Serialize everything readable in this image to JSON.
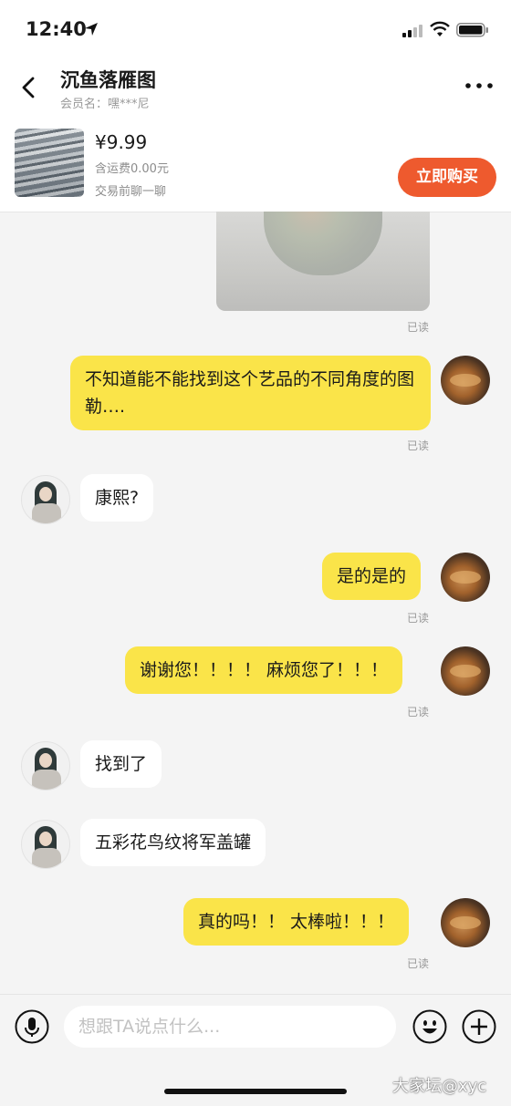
{
  "status_bar": {
    "time": "12:40"
  },
  "header": {
    "title": "沉鱼落雁图",
    "subtitle": "会员名：嘿***尼"
  },
  "product": {
    "price": "¥9.99",
    "shipping": "含运费0.00元",
    "note": "交易前聊一聊",
    "buy_label": "立即购买"
  },
  "messages": {
    "read_label": "已读",
    "m1": "不知道能不能找到这个艺品的不同角度的图勒….",
    "m2": "康熙?",
    "m3": "是的是的",
    "m4": "谢谢您！！！！ 麻烦您了！！！",
    "m5": "找到了",
    "m6": "五彩花鸟纹将军盖罐",
    "m7": "真的吗！！ 太棒啦！！！"
  },
  "input": {
    "placeholder": "想跟TA说点什么..."
  },
  "watermark": "大家坛@xyc",
  "colors": {
    "accent": "#ee5a2e",
    "my_bubble": "#fae449",
    "background": "#f4f4f4"
  },
  "icons": [
    "location-arrow-icon",
    "signal-icon",
    "wifi-icon",
    "battery-icon",
    "back-icon",
    "more-icon",
    "mic-icon",
    "emoji-icon",
    "plus-icon"
  ]
}
